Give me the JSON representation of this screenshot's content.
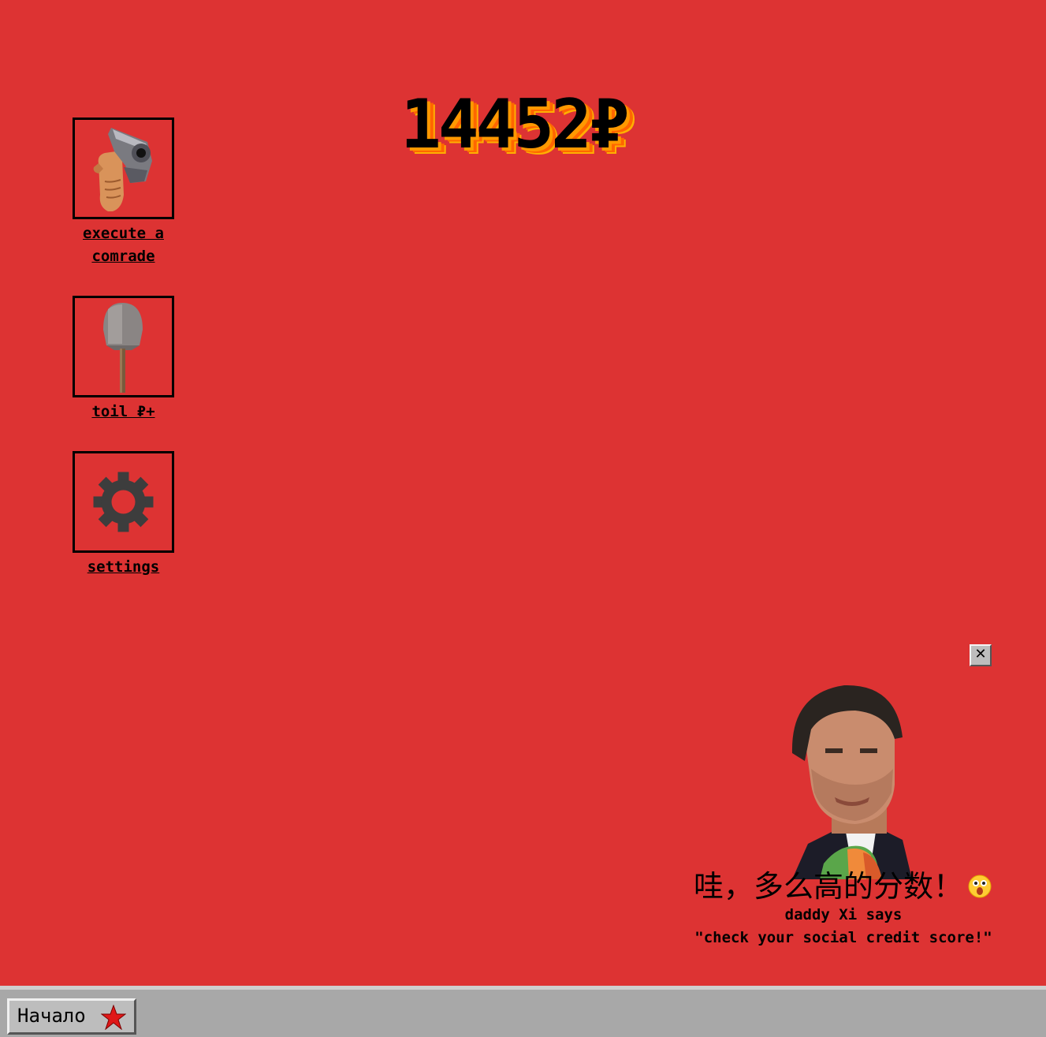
{
  "score": {
    "value": "14452₽"
  },
  "desktop_icons": [
    {
      "id": "execute",
      "label": "execute a comrade",
      "icon": "pistol-hand-icon"
    },
    {
      "id": "toil",
      "label": "toil ₽+",
      "icon": "shovel-icon"
    },
    {
      "id": "settings",
      "label": "settings",
      "icon": "gear-icon"
    }
  ],
  "popup": {
    "close_label": "✕",
    "headline": "哇，多么高的分数！",
    "emoji": "astonished-face-icon",
    "line1": "daddy Xi says",
    "line2": "\"check your social credit score!\""
  },
  "taskbar": {
    "start_label": "Начало",
    "start_icon": "red-star-icon"
  },
  "colors": {
    "background": "#dd3333",
    "taskbar": "#a8a8a8",
    "score_shadow": "#ff9900"
  }
}
